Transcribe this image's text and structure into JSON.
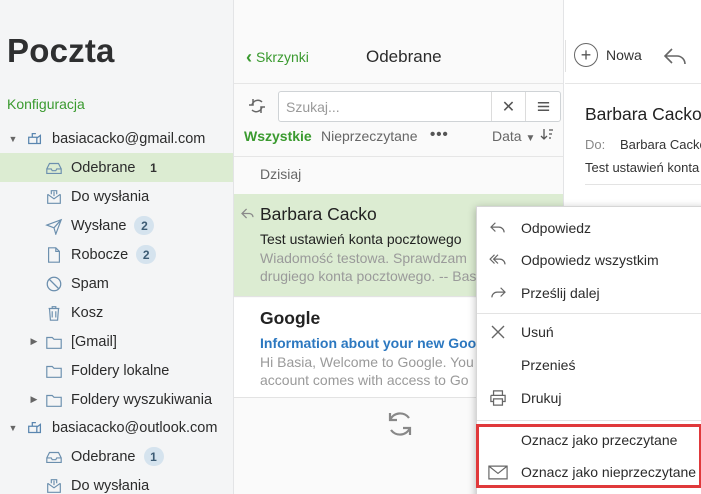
{
  "app": {
    "title": "Poczta"
  },
  "sidebar": {
    "config_link": "Konfiguracja",
    "accounts": [
      {
        "name": "basiacacko@gmail.com",
        "folders": [
          {
            "label": "Odebrane",
            "badge": "1",
            "icon": "inbox-icon"
          },
          {
            "label": "Do wysłania",
            "badge": "",
            "icon": "outbox-icon"
          },
          {
            "label": "Wysłane",
            "badge": "2",
            "icon": "sent-icon"
          },
          {
            "label": "Robocze",
            "badge": "2",
            "icon": "drafts-icon"
          },
          {
            "label": "Spam",
            "badge": "",
            "icon": "spam-icon"
          },
          {
            "label": "Kosz",
            "badge": "",
            "icon": "trash-icon"
          },
          {
            "label": "[Gmail]",
            "badge": "",
            "icon": "folder-icon"
          },
          {
            "label": "Foldery lokalne",
            "badge": "",
            "icon": "folder-icon"
          },
          {
            "label": "Foldery wyszukiwania",
            "badge": "",
            "icon": "folder-icon"
          }
        ]
      },
      {
        "name": "basiacacko@outlook.com",
        "folders": [
          {
            "label": "Odebrane",
            "badge": "1",
            "icon": "inbox-icon"
          },
          {
            "label": "Do wysłania",
            "badge": "",
            "icon": "outbox-icon"
          }
        ]
      }
    ]
  },
  "list": {
    "back_label": "Skrzynki",
    "title": "Odebrane",
    "search_placeholder": "Szukaj...",
    "filter_all": "Wszystkie",
    "filter_unread": "Nieprzeczytane",
    "filter_more": "•••",
    "sort_label": "Data",
    "group_today": "Dzisiaj",
    "messages": [
      {
        "from": "Barbara Cacko",
        "subject": "Test ustawień konta pocztowego",
        "preview_line1": "Wiadomość testowa. Sprawdzam",
        "preview_line2": "drugiego konta pocztowego. -- Bas"
      },
      {
        "from": "Google",
        "subject": "Information about your new Googl",
        "preview_line1": "Hi Basia, Welcome to Google. You",
        "preview_line2": "account comes with access to Go"
      }
    ]
  },
  "pane": {
    "new_label": "Nowa",
    "from": "Barbara Cacko",
    "to_label": "Do:",
    "to": "Barbara Cacko",
    "subject": "Test ustawień konta"
  },
  "context_menu": {
    "items": [
      {
        "label": "Odpowiedz",
        "icon": "reply-icon"
      },
      {
        "label": "Odpowiedz wszystkim",
        "icon": "reply-all-icon"
      },
      {
        "label": "Prześlij dalej",
        "icon": "forward-icon"
      },
      {
        "label": "Usuń",
        "icon": "delete-icon"
      },
      {
        "label": "Przenieś",
        "icon": ""
      },
      {
        "label": "Drukuj",
        "icon": "print-icon"
      },
      {
        "label": "Oznacz jako przeczytane",
        "icon": ""
      },
      {
        "label": "Oznacz jako nieprzeczytane",
        "icon": "envelope-icon"
      }
    ]
  },
  "colors": {
    "accent_green": "#3a9a2f",
    "selected_bg": "#dcecd2",
    "highlight_red": "#e0393b",
    "link_blue": "#2c78c0"
  }
}
